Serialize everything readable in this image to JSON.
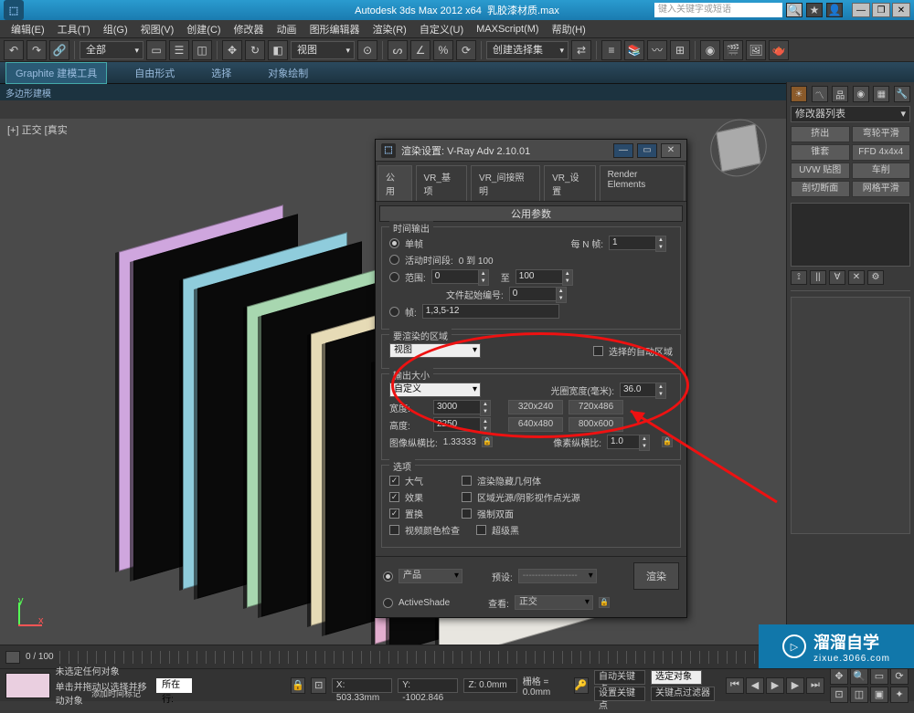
{
  "title": {
    "app": "Autodesk 3ds Max 2012 x64",
    "file": "乳胶漆材质.max",
    "search_placeholder": "键入关键字或短语"
  },
  "menu": [
    "编辑(E)",
    "工具(T)",
    "组(G)",
    "视图(V)",
    "创建(C)",
    "修改器",
    "动画",
    "图形编辑器",
    "渲染(R)",
    "自定义(U)",
    "MAXScript(M)",
    "帮助(H)"
  ],
  "toolbar_dd1": "全部",
  "toolbar_dd2": "视图",
  "toolbar_dd3": "创建选择集",
  "ribbon": {
    "tabs": [
      "Graphite 建模工具",
      "自由形式",
      "选择",
      "对象绘制"
    ],
    "sub": "多边形建模"
  },
  "viewport_label": "[+] 正交 [真实",
  "right_panel": {
    "dd": "修改器列表",
    "buttons": [
      "挤出",
      "弯轮平滑",
      "锥套",
      "FFD 4x4x4",
      "UVW 贴图",
      "车削",
      "剖切断面",
      "网格平滑"
    ]
  },
  "dialog": {
    "title": "渲染设置: V-Ray Adv 2.10.01",
    "tabs": [
      "公用",
      "VR_基项",
      "VR_间接照明",
      "VR_设置",
      "Render Elements"
    ],
    "rollout": "公用参数",
    "time_output": {
      "legend": "时间输出",
      "single": "单帧",
      "every_n_label": "每 N 帧:",
      "every_n": "1",
      "active": "活动时间段:",
      "active_range": "0 到 100",
      "range": "范围:",
      "from": "0",
      "to_lbl": "至",
      "to": "100",
      "file_start": "文件起始编号:",
      "file_start_v": "0",
      "frames": "帧:",
      "frames_v": "1,3,5-12"
    },
    "area": {
      "legend": "要渲染的区域",
      "dd": "视图",
      "auto": "选择的自动区域"
    },
    "output": {
      "legend": "输出大小",
      "dd": "自定义",
      "aperture_lbl": "光圈宽度(毫米):",
      "aperture": "36.0",
      "w_lbl": "宽度:",
      "w": "3000",
      "h_lbl": "高度:",
      "h": "2250",
      "p1": "320x240",
      "p2": "640x480",
      "p3": "720x486",
      "p4": "800x600",
      "img_aspect_lbl": "图像纵横比:",
      "img_aspect": "1.33333",
      "px_aspect_lbl": "像素纵横比:",
      "px_aspect": "1.0"
    },
    "options": {
      "legend": "选项",
      "atmo": "大气",
      "hidden": "渲染隐藏几何体",
      "fx": "效果",
      "arealight": "区域光源/阴影视作点光源",
      "disp": "置换",
      "twoside": "强制双面",
      "vidclr": "视频颜色检查",
      "superblk": "超级黑"
    },
    "bottom": {
      "prod": "产品",
      "preset_lbl": "预设:",
      "preset_dd": "------------------",
      "as": "ActiveShade",
      "view_lbl": "查看:",
      "view_dd": "正交",
      "render_btn": "渲染"
    }
  },
  "timeline": {
    "range": "0 / 100"
  },
  "status": {
    "none": "未选定任何对象",
    "hint": "单击并拖动以选择并移动对象",
    "x": "X: 503.33mm",
    "y": "Y: -1002.846",
    "z": "Z: 0.0mm",
    "grid": "栅格 = 0.0mm",
    "auto_key": "自动关键点",
    "sel_lock": "选定对象",
    "addtime": "添加时间标记",
    "setkey": "设置关键点",
    "keyfilter": "关键点过滤器",
    "row_label": "所在行:"
  },
  "watermark": {
    "brand": "溜溜自学",
    "url": "zixue.3066.com"
  }
}
